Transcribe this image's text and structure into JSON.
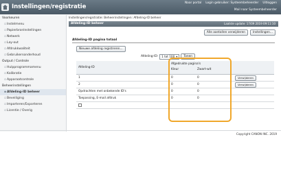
{
  "header": {
    "title": "Instellingen/registratie",
    "links": [
      "Naar portal",
      "Login gebruiker: Systeembeheerder",
      "Uitloggen"
    ],
    "mail_admin": "Mail naar Systeembeheerder"
  },
  "sidebar": {
    "sections": [
      {
        "label": "Voorkeuren",
        "items": [
          "Instelmenu",
          "Papierbronlnstellingen",
          "Netwerk",
          "Lay-out",
          "Afdrukkwaliteit",
          "Gebruikersonderhoud"
        ]
      },
      {
        "label": "Output / Controle",
        "items": [
          "Hulpprogrammamenu",
          "Kalibratie",
          "Apparaatcontrole"
        ]
      },
      {
        "label": "Beheerinstellingen",
        "items": [
          "Afdeling-ID beheer",
          "Beveiliging",
          "Importeren/Exporteren",
          "Licentie / Overig"
        ]
      }
    ],
    "active": "Afdeling-ID beheer"
  },
  "main": {
    "breadcrumb": "Instellingen/registratie: Beheerinstellingen: Afdeling-ID beheer",
    "panel_title": "Afdeling-ID beheer",
    "last_updated": "Laatste update: 17/09 2019 09:11:10",
    "buttons": {
      "clear_all": "Alle aantallen verwijderen",
      "settings": "Instellingen..."
    },
    "section_title": "Afdeling-ID pagina totaal",
    "new_button": "Nieuwe afdeling registreren...",
    "filter_label": "Afdeling-ID:",
    "filter_value": "1 tot 100",
    "show_button": "Tonen"
  },
  "table": {
    "col_id": "Afdeling-ID",
    "col_group": "Afgedrukte pagina's",
    "col_color": "Kleur",
    "col_bw": "Zwart-wit",
    "delete_label": "Verwijderen",
    "rows": [
      {
        "name": "1",
        "color": "0",
        "bw": "0",
        "delete": true
      },
      {
        "name": "2",
        "color": "0",
        "bw": "0",
        "delete": true
      },
      {
        "name": "Opdrachten met onbekende ID's",
        "color": "0",
        "bw": "0",
        "delete": false
      },
      {
        "name": "Toepassing, E-mail afdruk",
        "color": "0",
        "bw": "0",
        "delete": false
      }
    ]
  },
  "footer": {
    "copyright": "Copyright CANON INC. 2019"
  },
  "colors": {
    "highlight": "#f0a72a",
    "header_bg": "#5e6b75"
  }
}
